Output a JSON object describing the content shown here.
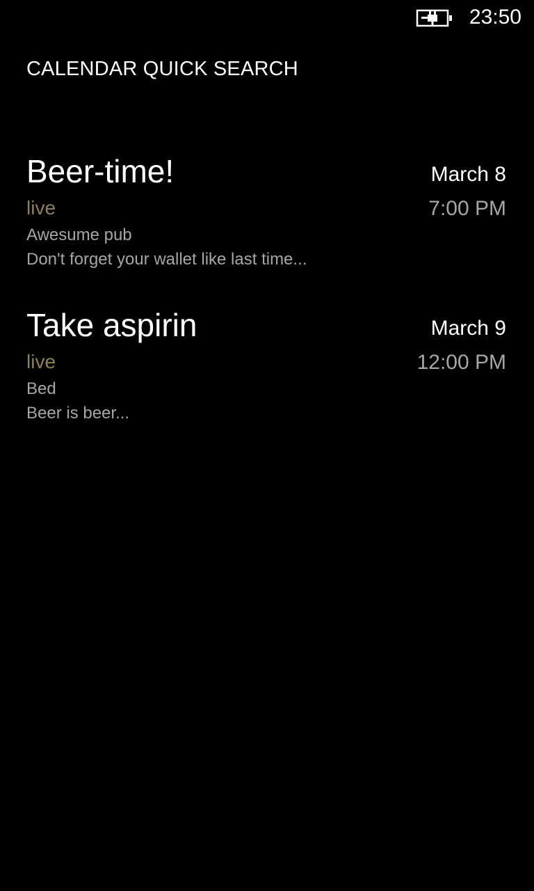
{
  "status_bar": {
    "battery_icon": "battery-charging-icon",
    "time": "23:50"
  },
  "app": {
    "title": "CALENDAR QUICK SEARCH"
  },
  "results": [
    {
      "title": "Beer-time!",
      "calendar": "live",
      "location": "Awesume pub",
      "notes": "Don't forget your wallet like last time...",
      "date": "March 8",
      "time": "7:00 PM"
    },
    {
      "title": "Take aspirin",
      "calendar": "live",
      "location": "Bed",
      "notes": "Beer is beer...",
      "date": "March 9",
      "time": "12:00 PM"
    }
  ],
  "colors": {
    "background": "#000000",
    "primary_text": "#ffffff",
    "secondary_text": "#a6a6a6",
    "calendar_accent": "#8e8057"
  }
}
